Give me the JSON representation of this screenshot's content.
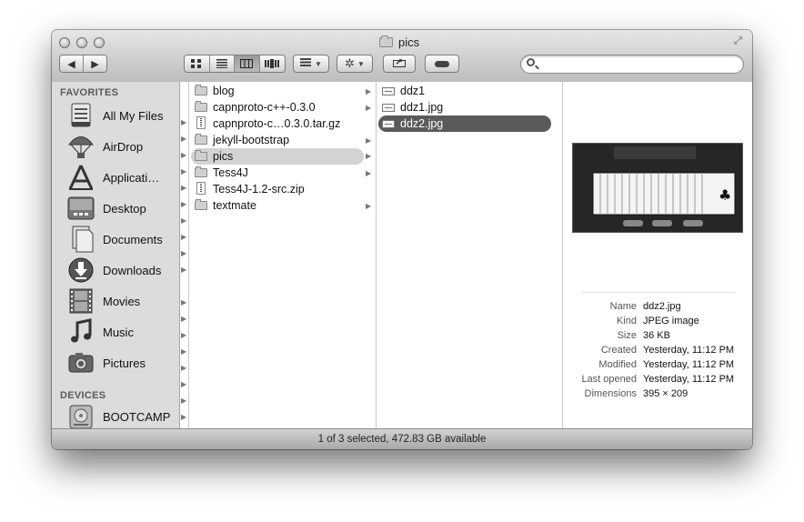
{
  "window": {
    "title": "pics",
    "status": "1 of 3 selected, 472.83 GB available"
  },
  "toolbar": {
    "back_icon": "back-arrow-icon",
    "forward_icon": "forward-arrow-icon",
    "views": [
      "icon-view",
      "list-view",
      "column-view",
      "coverflow-view"
    ],
    "active_view": "column-view",
    "search": {
      "placeholder": "",
      "value": ""
    }
  },
  "sidebar": {
    "favorites_label": "FAVORITES",
    "devices_label": "DEVICES",
    "favorites": [
      {
        "label": "All My Files",
        "icon": "all-my-files-icon"
      },
      {
        "label": "AirDrop",
        "icon": "airdrop-icon"
      },
      {
        "label": "Applicati…",
        "icon": "applications-icon"
      },
      {
        "label": "Desktop",
        "icon": "desktop-icon"
      },
      {
        "label": "Documents",
        "icon": "documents-icon"
      },
      {
        "label": "Downloads",
        "icon": "downloads-icon"
      },
      {
        "label": "Movies",
        "icon": "movies-icon"
      },
      {
        "label": "Music",
        "icon": "music-icon"
      },
      {
        "label": "Pictures",
        "icon": "pictures-icon"
      }
    ],
    "devices": [
      {
        "label": "BOOTCAMP",
        "icon": "disk-icon"
      }
    ]
  },
  "column1": {
    "items": [
      {
        "name": "blog",
        "kind": "folder",
        "has_children": true
      },
      {
        "name": "capnproto-c++-0.3.0",
        "kind": "folder",
        "has_children": true
      },
      {
        "name": "capnproto-c…0.3.0.tar.gz",
        "kind": "zip",
        "has_children": false
      },
      {
        "name": "jekyll-bootstrap",
        "kind": "folder",
        "has_children": true
      },
      {
        "name": "pics",
        "kind": "folder",
        "has_children": true,
        "selected": true
      },
      {
        "name": "Tess4J",
        "kind": "folder",
        "has_children": true
      },
      {
        "name": "Tess4J-1.2-src.zip",
        "kind": "zip",
        "has_children": false
      },
      {
        "name": "textmate",
        "kind": "folder",
        "has_children": true
      }
    ]
  },
  "column2": {
    "items": [
      {
        "name": "ddz1",
        "kind": "image"
      },
      {
        "name": "ddz1.jpg",
        "kind": "image"
      },
      {
        "name": "ddz2.jpg",
        "kind": "image",
        "selected": true
      }
    ]
  },
  "preview": {
    "info": [
      {
        "key": "Name",
        "value": "ddz2.jpg"
      },
      {
        "key": "Kind",
        "value": "JPEG image"
      },
      {
        "key": "Size",
        "value": "36 KB"
      },
      {
        "key": "Created",
        "value": "Yesterday, 11:12 PM"
      },
      {
        "key": "Modified",
        "value": "Yesterday, 11:12 PM"
      },
      {
        "key": "Last opened",
        "value": "Yesterday, 11:12 PM"
      },
      {
        "key": "Dimensions",
        "value": "395 × 209"
      }
    ]
  }
}
